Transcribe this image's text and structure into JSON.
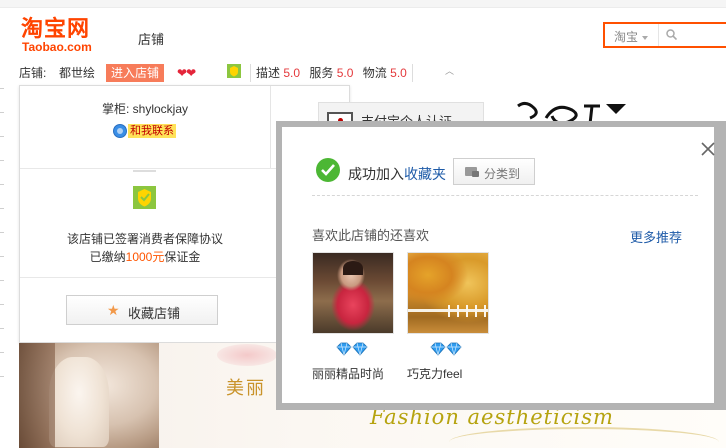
{
  "header": {
    "logo_cn": "淘宝网",
    "logo_en": "Taobao.com",
    "shop_label": "店铺",
    "search": {
      "scope": "淘宝"
    }
  },
  "shopbar": {
    "label": "店铺:",
    "shop_name": "都世绘",
    "enter_shop": "进入店铺",
    "credit_icon": "heart-icon",
    "ratings": [
      {
        "key": "描述",
        "value": "5.0"
      },
      {
        "key": "服务",
        "value": "5.0"
      },
      {
        "key": "物流",
        "value": "5.0"
      }
    ]
  },
  "shop_panel": {
    "owner": "掌柜: shylockjay",
    "contact": "和我联系",
    "cert": "支付宝个人认证",
    "assurance_line1": "该店铺已签署消费者保障协议",
    "assurance_pre": "已缴纳",
    "assurance_amount": "1000元",
    "assurance_post": "保证金",
    "favorite_button": "收藏店铺"
  },
  "popup": {
    "success_pre": "成功加入",
    "success_link": "收藏夹",
    "categorize_button": "分类到",
    "also_like": "喜欢此店铺的还喜欢",
    "more_recommend": "更多推荐",
    "items": [
      {
        "name": "丽丽精品时尚",
        "level_icon": "diamond-icon",
        "level_count": 2
      },
      {
        "name": "巧克力feel",
        "level_icon": "diamond-icon",
        "level_count": 2
      }
    ]
  },
  "banner": {
    "cn_text": "美丽",
    "en_text": "Fashion aestheticism"
  },
  "colors": {
    "brand": "#ff4400",
    "accent": "#f77c5a",
    "rating": "#e4393c",
    "link": "#1e5ba8",
    "success": "#4cb734"
  }
}
